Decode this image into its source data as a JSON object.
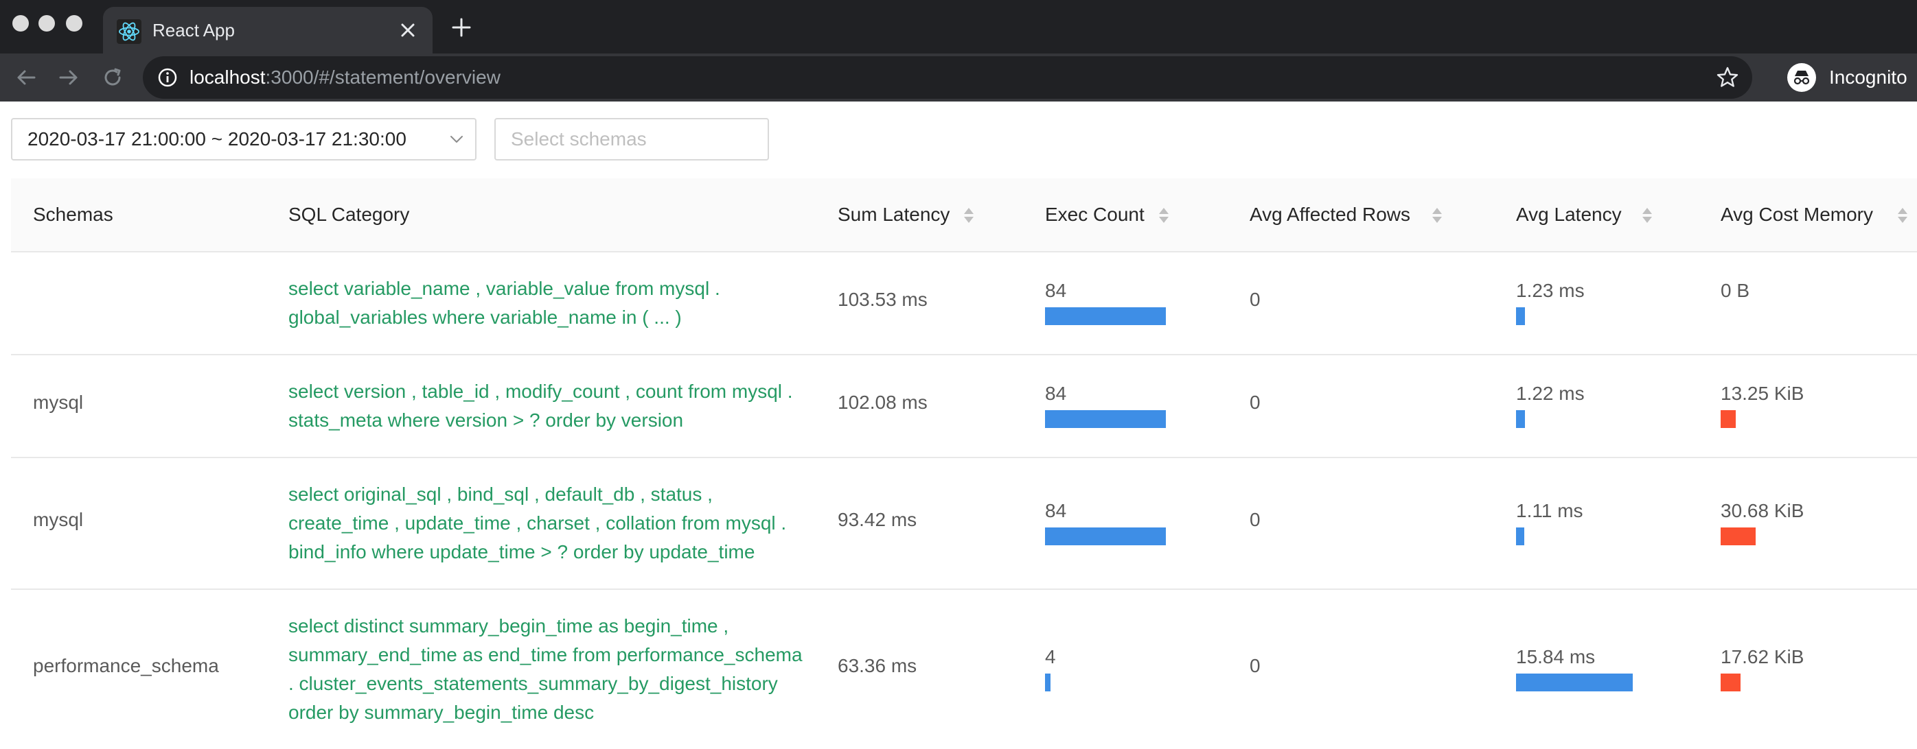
{
  "browser": {
    "tab_title": "React App",
    "url_host": "localhost",
    "url_rest": ":3000/#/statement/overview",
    "profile_label": "Incognito"
  },
  "filters": {
    "time_range": "2020-03-17 21:00:00 ~ 2020-03-17 21:30:00",
    "schemas_placeholder": "Select schemas"
  },
  "table": {
    "columns": [
      "Schemas",
      "SQL Category",
      "Sum Latency",
      "Exec Count",
      "Avg Affected Rows",
      "Avg Latency",
      "Avg Cost Memory"
    ],
    "rows": [
      {
        "schema": "",
        "sql": [
          "select variable_name , variable_value from mysql .",
          "global_variables where variable_name in ( ... )"
        ],
        "sum_latency": "103.53 ms",
        "exec_count": "84",
        "exec_count_ratio": 1.0,
        "avg_affected_rows": "0",
        "avg_latency": "1.23 ms",
        "avg_latency_ratio": 0.078,
        "avg_cost_memory": "0 B",
        "avg_cost_memory_ratio": 0
      },
      {
        "schema": "mysql",
        "sql": [
          "select version , table_id , modify_count , count from mysql .",
          "stats_meta where version > ? order by version"
        ],
        "sum_latency": "102.08 ms",
        "exec_count": "84",
        "exec_count_ratio": 1.0,
        "avg_affected_rows": "0",
        "avg_latency": "1.22 ms",
        "avg_latency_ratio": 0.077,
        "avg_cost_memory": "13.25 KiB",
        "avg_cost_memory_ratio": 0.43
      },
      {
        "schema": "mysql",
        "sql": [
          "select original_sql , bind_sql , default_db , status ,",
          "create_time , update_time , charset , collation from mysql .",
          "bind_info where update_time > ? order by update_time"
        ],
        "sum_latency": "93.42 ms",
        "exec_count": "84",
        "exec_count_ratio": 1.0,
        "avg_affected_rows": "0",
        "avg_latency": "1.11 ms",
        "avg_latency_ratio": 0.07,
        "avg_cost_memory": "30.68 KiB",
        "avg_cost_memory_ratio": 1.0
      },
      {
        "schema": "performance_schema",
        "sql": [
          "select distinct summary_begin_time as begin_time ,",
          "summary_end_time as end_time from performance_schema",
          ". cluster_events_statements_summary_by_digest_history",
          "order by summary_begin_time desc"
        ],
        "sum_latency": "63.36 ms",
        "exec_count": "4",
        "exec_count_ratio": 0.048,
        "avg_affected_rows": "0",
        "avg_latency": "15.84 ms",
        "avg_latency_ratio": 1.0,
        "avg_cost_memory": "17.62 KiB",
        "avg_cost_memory_ratio": 0.57
      }
    ]
  },
  "colors": {
    "sql_link": "#259a63",
    "bar_blue": "#3e8ee6",
    "bar_red": "#fb5030"
  }
}
